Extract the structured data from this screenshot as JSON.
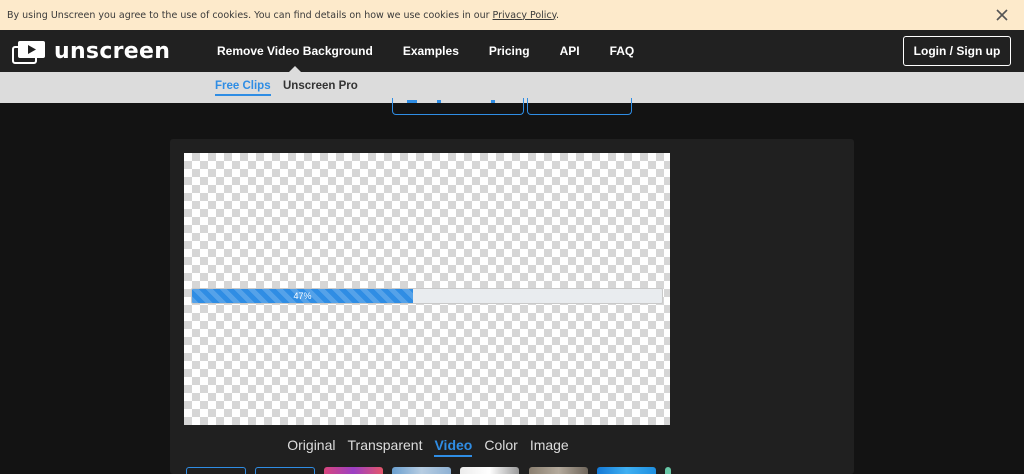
{
  "cookie_bar": {
    "text": "By using Unscreen you agree to the use of cookies. You can find details on how we use cookies in our ",
    "link": "Privacy Policy",
    "suffix": "."
  },
  "header": {
    "logo_text": "unscreen",
    "nav": [
      {
        "label": "Remove Video Background",
        "active": true
      },
      {
        "label": "Examples"
      },
      {
        "label": "Pricing"
      },
      {
        "label": "API"
      },
      {
        "label": "FAQ"
      }
    ],
    "login_label": "Login / Sign up"
  },
  "subnav": {
    "items": [
      {
        "label": "Free Clips",
        "active": true
      },
      {
        "label": "Unscreen Pro"
      }
    ]
  },
  "editor": {
    "progress_label": "47%",
    "progress_value": 47,
    "view_tabs": [
      {
        "label": "Original"
      },
      {
        "label": "Transparent"
      },
      {
        "label": "Video",
        "active": true
      },
      {
        "label": "Color"
      },
      {
        "label": "Image"
      }
    ]
  },
  "colors": {
    "accent": "#2f8de4",
    "cookie_bg": "#fdeacb",
    "header_bg": "#212121",
    "subnav_bg": "#dcdcdc",
    "page_bg": "#131313",
    "panel_bg": "#202020"
  },
  "icons": {
    "logo": "play-icon",
    "cookie_close": "close-icon"
  }
}
